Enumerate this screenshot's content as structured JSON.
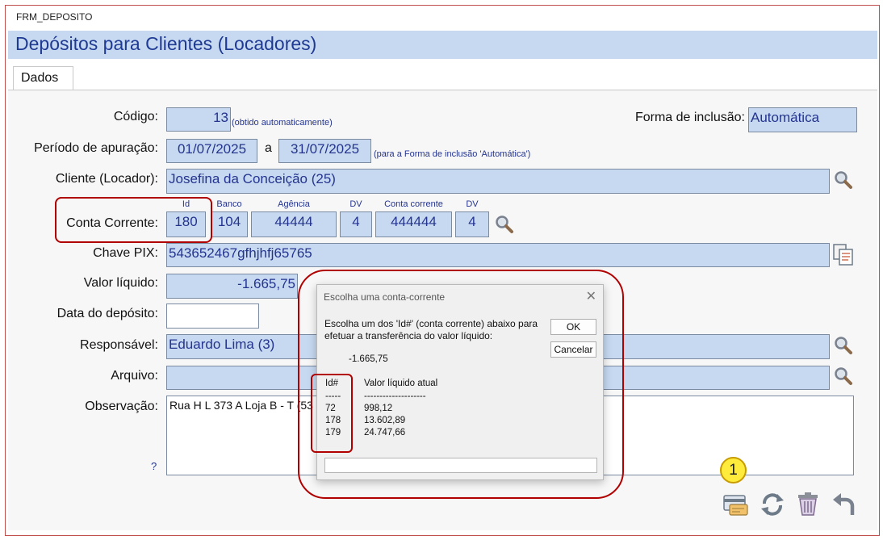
{
  "window": {
    "title": "FRM_DEPOSITO"
  },
  "header": {
    "title": "Depósitos para Clientes (Locadores)"
  },
  "tabs": [
    {
      "label": "Dados"
    }
  ],
  "form": {
    "codigo": {
      "label": "Código:",
      "value": "13",
      "note": "(obtido automaticamente)"
    },
    "forma_inclusao": {
      "label": "Forma de inclusão:",
      "value": "Automática"
    },
    "periodo": {
      "label": "Período de apuração:",
      "start": "01/07/2025",
      "sep": "a",
      "end": "31/07/2025",
      "note": "(para a Forma de inclusão 'Automática')"
    },
    "cliente": {
      "label": "Cliente (Locador):",
      "value": "Josefina da Conceição (25)"
    },
    "conta": {
      "label": "Conta Corrente:",
      "headers": {
        "id": "Id",
        "banco": "Banco",
        "agencia": "Agência",
        "dv1": "DV",
        "conta": "Conta corrente",
        "dv2": "DV"
      },
      "id": "180",
      "banco": "104",
      "agencia": "44444",
      "dv1": "4",
      "conta": "444444",
      "dv2": "4"
    },
    "pix": {
      "label": "Chave PIX:",
      "value": "543652467gfhjhfj65765"
    },
    "valor": {
      "label": "Valor líquido:",
      "value": "-1.665,75"
    },
    "data_deposito": {
      "label": "Data do depósito:",
      "value": ""
    },
    "responsavel": {
      "label": "Responsável:",
      "value": "Eduardo Lima (3)"
    },
    "arquivo": {
      "label": "Arquivo:",
      "value": ""
    },
    "observacao": {
      "label": "Observação:",
      "value": "Rua H L 373 A Loja B - T (53",
      "help": "?"
    }
  },
  "dialog": {
    "title": "Escolha uma conta-corrente",
    "close": "✕",
    "message": "Escolha um dos 'Id#' (conta corrente) abaixo para\nefetuar a transferência do valor líquido:",
    "amount": "-1.665,75",
    "col_id": "Id#",
    "col_valor": "Valor líquido atual",
    "sep_id": "-----",
    "sep_valor": "--------------------",
    "rows": [
      {
        "id": "72",
        "valor": "998,12"
      },
      {
        "id": "178",
        "valor": "13.602,89"
      },
      {
        "id": "179",
        "valor": "24.747,66"
      }
    ],
    "ok": "OK",
    "cancel": "Cancelar",
    "input": ""
  },
  "annotation": {
    "badge": "1"
  },
  "icons": [
    "search-icon",
    "copy-icon",
    "deposit-card-icon",
    "refresh-icon",
    "trash-icon",
    "undo-icon"
  ],
  "colors": {
    "field_bg": "#c6d9f1",
    "field_text": "#24348f",
    "header_bg": "#c6d9f1",
    "highlight": "#b00000"
  }
}
